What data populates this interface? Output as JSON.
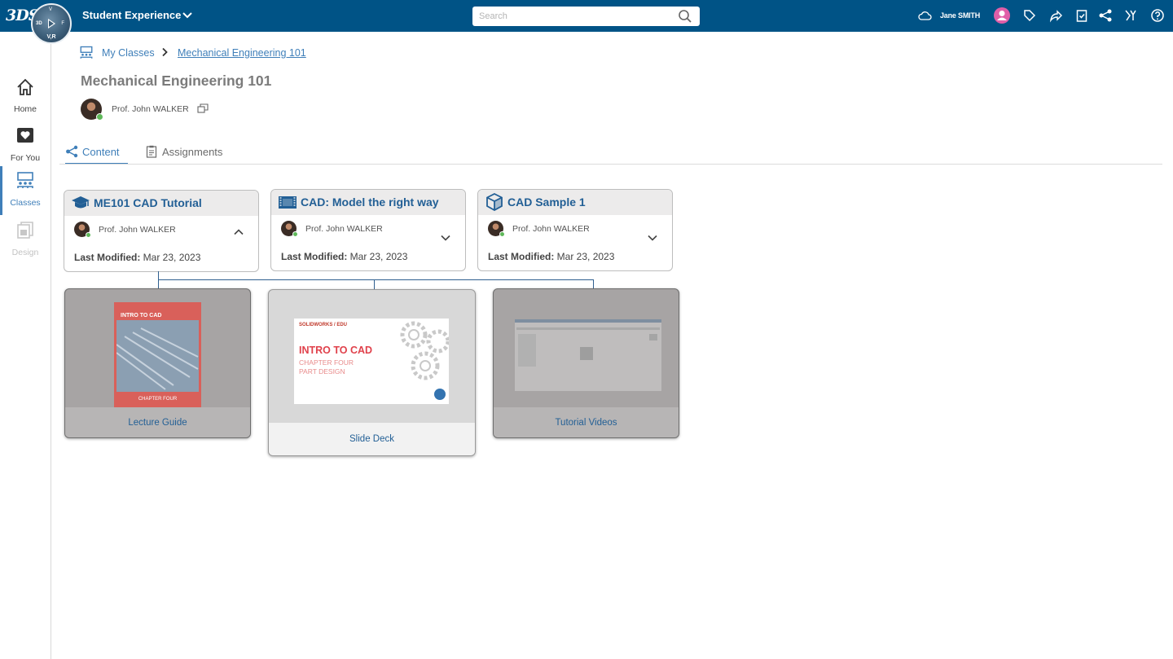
{
  "topbar": {
    "logo": "3DS",
    "compass": {
      "top": "V",
      "left": "3D",
      "right": "F",
      "bottom": "V,R"
    },
    "app_title": "Student Experience",
    "search_placeholder": "Search",
    "user_name": "Jane SMITH",
    "colors": {
      "bar": "#005386",
      "avatar": "#e05fa8"
    }
  },
  "sidebar": {
    "items": [
      {
        "label": "Home",
        "icon": "home-icon"
      },
      {
        "label": "For You",
        "icon": "heart-icon"
      },
      {
        "label": "Classes",
        "icon": "classes-icon",
        "active": true
      },
      {
        "label": "Design",
        "icon": "design-icon",
        "disabled": true
      }
    ]
  },
  "breadcrumb": {
    "parent": "My Classes",
    "current": "Mechanical Engineering 101"
  },
  "page": {
    "title": "Mechanical Engineering 101",
    "professor": "Prof. John WALKER"
  },
  "tabs": [
    {
      "label": "Content",
      "active": true
    },
    {
      "label": "Assignments"
    }
  ],
  "cards": [
    {
      "title": "ME101 CAD Tutorial",
      "icon": "graduation-cap-icon",
      "professor": "Prof. John WALKER",
      "modified_label": "Last Modified:",
      "modified": "Mar 23, 2023",
      "expanded": true
    },
    {
      "title": "CAD: Model the right way",
      "icon": "film-icon",
      "professor": "Prof. John WALKER",
      "modified_label": "Last Modified:",
      "modified": "Mar 23, 2023",
      "expanded": false
    },
    {
      "title": "CAD Sample 1",
      "icon": "cube-icon",
      "professor": "Prof. John WALKER",
      "modified_label": "Last Modified:",
      "modified": "Mar 23, 2023",
      "expanded": false
    }
  ],
  "resources": [
    {
      "label": "Lecture Guide",
      "thumb_title": "INTRO TO CAD",
      "thumb_footer": "CHAPTER FOUR"
    },
    {
      "label": "Slide Deck",
      "thumb_brand": "SOLIDWORKS / EDU",
      "thumb_title": "INTRO TO CAD",
      "thumb_sub1": "CHAPTER FOUR",
      "thumb_sub2": "PART DESIGN"
    },
    {
      "label": "Tutorial Videos"
    }
  ]
}
